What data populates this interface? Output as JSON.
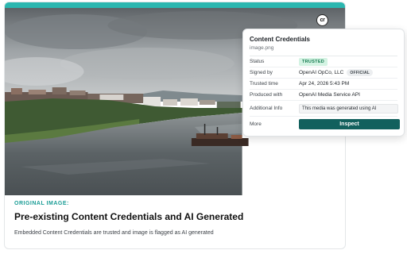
{
  "colors": {
    "accent": "#2bb7b0",
    "kicker": "#1b9d96",
    "button": "#12605d"
  },
  "card": {
    "badge": {
      "icon": "cr-icon",
      "text": "cr"
    },
    "image_label": "ORIGINAL IMAGE:",
    "title": "Pre-existing Content Credentials and AI Generated",
    "description": "Embedded Content Credentials are trusted and image is flagged as AI generated"
  },
  "panel": {
    "title": "Content Credentials",
    "subtitle": "image.png",
    "rows": {
      "status": {
        "label": "Status",
        "value": "TRUSTED"
      },
      "signed_by": {
        "label": "Signed by",
        "value": "OpenAI OpCo, LLC",
        "badge": "OFFICIAL"
      },
      "trusted_time": {
        "label": "Trusted time",
        "value": "Apr 24, 2026 5:43 PM"
      },
      "produced_with": {
        "label": "Produced with",
        "value": "OpenAI Media Service API"
      },
      "additional_info": {
        "label": "Additional Info",
        "value": "This media was generated using AI"
      },
      "more": {
        "label": "More",
        "button": "Inspect"
      }
    }
  }
}
